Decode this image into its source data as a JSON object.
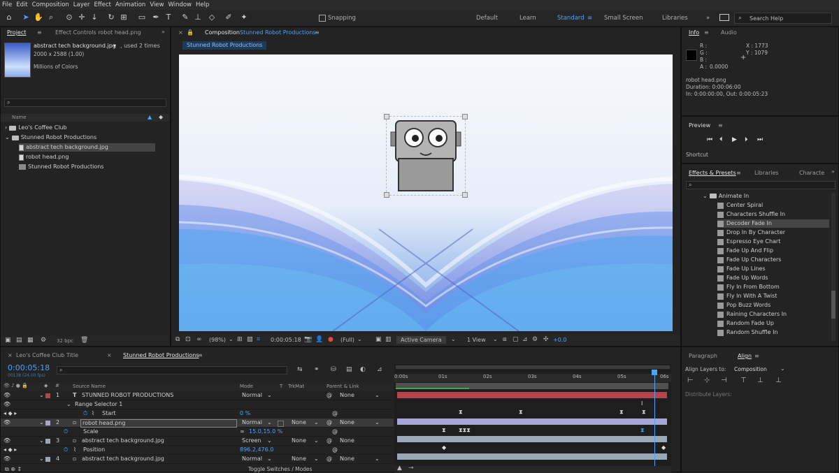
{
  "menu": [
    "File",
    "Edit",
    "Composition",
    "Layer",
    "Effect",
    "Animation",
    "View",
    "Window",
    "Help"
  ],
  "toolbar": {
    "snapping": "Snapping",
    "workspaces": [
      "Default",
      "Learn",
      "Standard",
      "Small Screen",
      "Libraries"
    ],
    "active_workspace": "Standard",
    "search_help": "Search Help"
  },
  "project": {
    "tab": "Project",
    "effect_controls_tab": "Effect Controls robot head.png",
    "selected_name": "abstract tech background.jpg",
    "used_times": ", used 2 times",
    "dims": "2000 x 2588 (1.00)",
    "color": "Millions of Colors",
    "column_name": "Name",
    "items": [
      {
        "name": "Leo's Coffee Club",
        "type": "folder"
      },
      {
        "name": "Stunned Robot Productions",
        "type": "folder"
      },
      {
        "name": "abstract tech background.jpg",
        "type": "file"
      },
      {
        "name": "robot head.png",
        "type": "file"
      },
      {
        "name": "Stunned Robot Productions",
        "type": "comp"
      }
    ],
    "bpc": "32 bpc"
  },
  "composition": {
    "tab_prefix": "Composition",
    "tab_name": "Stunned Robot Productions",
    "breadcrumb": "Stunned Robot Productions",
    "zoom": "(98%)",
    "timecode": "0:00:05:18",
    "resolution": "(Full)",
    "camera": "Active Camera",
    "view": "1 View",
    "exposure": "+0.0"
  },
  "info": {
    "tab": "Info",
    "audio_tab": "Audio",
    "r": "R :",
    "g": "G :",
    "b": "B :",
    "a": "A :",
    "a_val": "0.0000",
    "x": "X : 1773",
    "y": "Y : 1079",
    "layer": "robot head.png",
    "duration": "Duration: 0:00:06:00",
    "inout": "In: 0:00:00:00, Out: 0:00:05:23"
  },
  "preview": {
    "title": "Preview",
    "shortcut": "Shortcut"
  },
  "effects": {
    "tab": "Effects & Presets",
    "libraries_tab": "Libraries",
    "character_tab": "Characte",
    "folder": "Animate In",
    "items": [
      "Center Spiral",
      "Characters Shuffle In",
      "Decoder Fade In",
      "Drop In By Character",
      "Espresso Eye Chart",
      "Fade Up And Flip",
      "Fade Up Characters",
      "Fade Up Lines",
      "Fade Up Words",
      "Fly In From Bottom",
      "Fly In With A Twist",
      "Pop Buzz Words",
      "Raining Characters In",
      "Random Fade Up",
      "Random Shuffle In"
    ],
    "selected": "Decoder Fade In"
  },
  "paragraph": {
    "tab": "Paragraph",
    "align_tab": "Align",
    "align_layers_to": "Align Layers to:",
    "align_target": "Composition",
    "distribute": "Distribute Layers:"
  },
  "timeline": {
    "tabs": [
      "Leo's Coffee Club Title",
      "Stunned Robot Productions"
    ],
    "timecode": "0:00:05:18",
    "fps": "00138 (24.00 fps)",
    "col_source": "Source Name",
    "col_mode": "Mode",
    "col_t": "T",
    "col_trkmat": "TrkMat",
    "col_parent": "Parent & Link",
    "ruler": [
      "0:00s",
      "01s",
      "02s",
      "03s",
      "04s",
      "05s",
      "06s"
    ],
    "rows": [
      {
        "num": "1",
        "name": "STUNNED ROBOT PRODUCTIONS",
        "mode": "Normal",
        "trkmat": "",
        "parent": "None",
        "kind": "layer"
      },
      {
        "num": "",
        "name": "Range Selector 1",
        "mode": "",
        "trkmat": "",
        "parent": "",
        "kind": "group"
      },
      {
        "num": "",
        "name": "Start",
        "mode": "0 %",
        "trkmat": "",
        "parent": "",
        "kind": "prop"
      },
      {
        "num": "2",
        "name": "robot head.png",
        "mode": "Normal",
        "trkmat": "None",
        "parent": "None",
        "kind": "layer"
      },
      {
        "num": "",
        "name": "Scale",
        "mode": "15.0,15.0 %",
        "trkmat": "",
        "parent": "",
        "kind": "prop"
      },
      {
        "num": "3",
        "name": "abstract tech background.jpg",
        "mode": "Screen",
        "trkmat": "None",
        "parent": "None",
        "kind": "layer"
      },
      {
        "num": "",
        "name": "Position",
        "mode": "896.2,476.0",
        "trkmat": "",
        "parent": "",
        "kind": "prop"
      },
      {
        "num": "4",
        "name": "abstract tech background.jpg",
        "mode": "Normal",
        "trkmat": "None",
        "parent": "None",
        "kind": "layer"
      }
    ],
    "toggle": "Toggle Switches / Modes"
  },
  "colors": {
    "accent": "#2d8ceb",
    "layer1": "#b5434b",
    "layer2": "#a9a6d4",
    "layer3": "#9aa7b6"
  }
}
